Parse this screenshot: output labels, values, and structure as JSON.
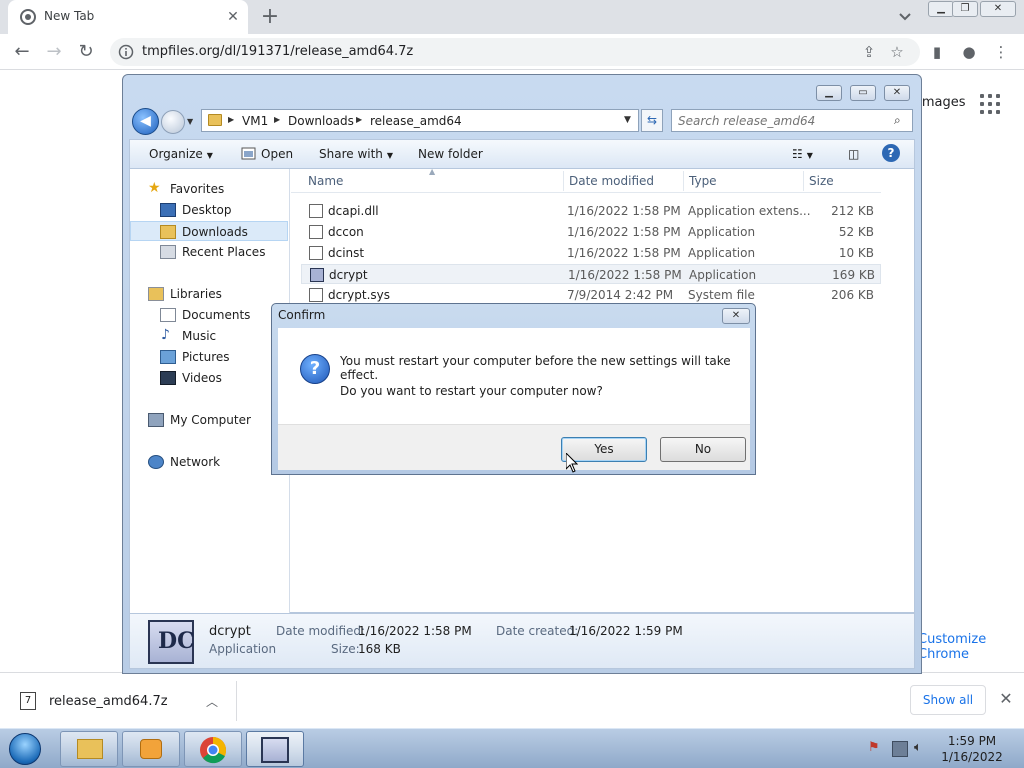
{
  "browser": {
    "tab_title": "New Tab",
    "url": "tmpfiles.org/dl/191371/release_amd64.7z",
    "ntp_images_label": "Images",
    "ntp_customize_label": "Customize Chrome"
  },
  "downloads": {
    "filename": "release_amd64.7z",
    "show_all_label": "Show all"
  },
  "explorer": {
    "breadcrumb": [
      "VM1",
      "Downloads",
      "release_amd64"
    ],
    "search_placeholder": "Search release_amd64",
    "commands": {
      "organize": "Organize",
      "open": "Open",
      "share_with": "Share with",
      "new_folder": "New folder"
    },
    "nav": {
      "favorites": "Favorites",
      "desktop": "Desktop",
      "downloads": "Downloads",
      "recent_places": "Recent Places",
      "libraries": "Libraries",
      "documents": "Documents",
      "music": "Music",
      "pictures": "Pictures",
      "videos": "Videos",
      "my_computer": "My Computer",
      "network": "Network"
    },
    "columns": {
      "name": "Name",
      "date_modified": "Date modified",
      "type": "Type",
      "size": "Size"
    },
    "files": [
      {
        "name": "dcapi.dll",
        "date": "1/16/2022 1:58 PM",
        "type": "Application extens...",
        "size": "212 KB"
      },
      {
        "name": "dccon",
        "date": "1/16/2022 1:58 PM",
        "type": "Application",
        "size": "52 KB"
      },
      {
        "name": "dcinst",
        "date": "1/16/2022 1:58 PM",
        "type": "Application",
        "size": "10 KB"
      },
      {
        "name": "dcrypt",
        "date": "1/16/2022 1:58 PM",
        "type": "Application",
        "size": "169 KB"
      },
      {
        "name": "dcrypt.sys",
        "date": "7/9/2014 2:42 PM",
        "type": "System file",
        "size": "206 KB"
      }
    ],
    "details": {
      "name": "dcrypt",
      "type": "Application",
      "date_modified_label": "Date modified:",
      "date_modified": "1/16/2022 1:58 PM",
      "size_label": "Size:",
      "size": "168 KB",
      "date_created_label": "Date created:",
      "date_created": "1/16/2022 1:59 PM"
    }
  },
  "dialog": {
    "title": "Confirm",
    "message1": "You must restart your computer before the new settings will take effect.",
    "message2": "Do you want to restart your computer now?",
    "yes_label": "Yes",
    "no_label": "No"
  },
  "taskbar": {
    "time": "1:59 PM",
    "date": "1/16/2022"
  }
}
